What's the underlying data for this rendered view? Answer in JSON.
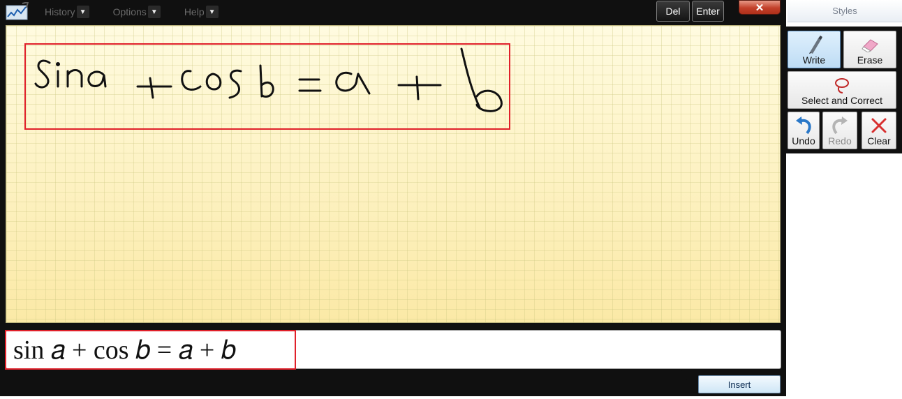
{
  "menu": [
    {
      "label": "History",
      "icon": "chevron-down-icon"
    },
    {
      "label": "Options",
      "icon": "chevron-down-icon"
    },
    {
      "label": "Help",
      "icon": "chevron-down-icon"
    }
  ],
  "edit_buttons": {
    "del": "Del",
    "enter": "Enter"
  },
  "close_glyph": "✕",
  "preview": {
    "formula": "sin 𝑎 + cos 𝑏 = 𝑎 + 𝑏"
  },
  "insert_label": "Insert",
  "styles_label": "Styles",
  "tools": {
    "write": "Write",
    "erase": "Erase",
    "select_correct": "Select and Correct",
    "undo": "Undo",
    "redo": "Redo",
    "clear": "Clear"
  },
  "colors": {
    "highlight_box": "#e0202a",
    "pad": "#fdf3bf",
    "active_tool": "#bedcf4"
  }
}
